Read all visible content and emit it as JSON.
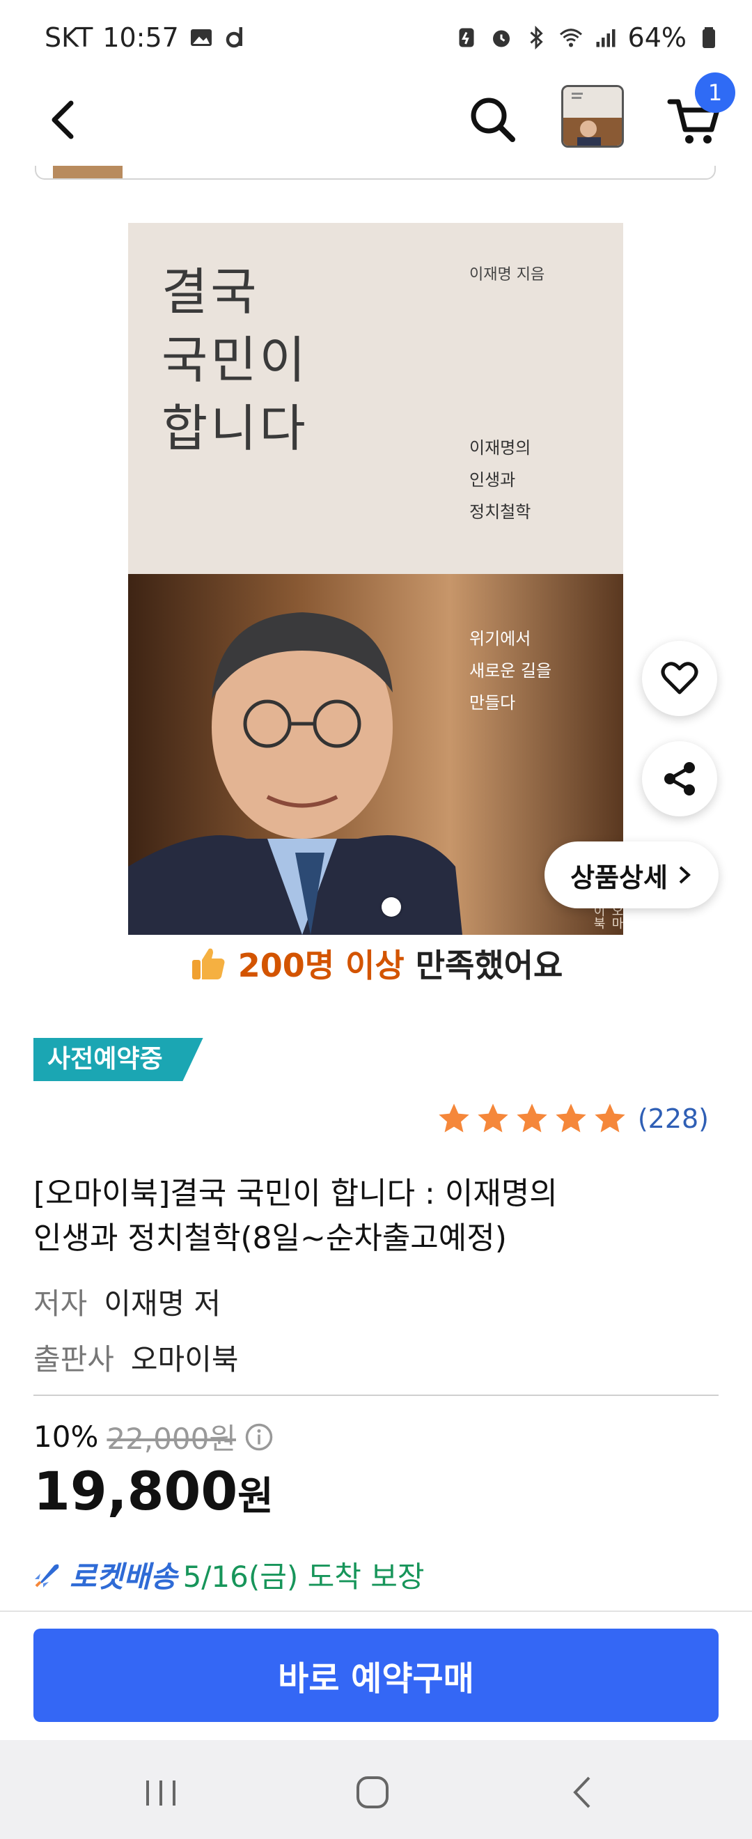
{
  "status_bar": {
    "carrier": "SKT",
    "time": "10:57",
    "battery": "64%"
  },
  "header": {
    "cart_count": "1"
  },
  "cover": {
    "title_lines": [
      "결국",
      "국민이",
      "합니다"
    ],
    "author": "이재명 지음",
    "subtitle_lines": [
      "이재명의",
      "인생과",
      "정치철학"
    ],
    "photo_text_lines": [
      "위기에서",
      "새로운 길을",
      "만들다"
    ],
    "publisher_mark": "오마이북"
  },
  "product": {
    "detail_button": "상품상세",
    "satisfaction_highlight": "200명 이상",
    "satisfaction_rest": "만족했어요",
    "preorder_badge": "사전예약중",
    "rating_count": "(228)",
    "title_line1": "[오마이북]결국 국민이 합니다 : 이재명의",
    "title_line2": "인생과 정치철학(8일~순차출고예정)",
    "author_label": "저자",
    "author_value": "이재명 저",
    "publisher_label": "출판사",
    "publisher_value": "오마이북",
    "discount": "10%",
    "original_price": "22,000원",
    "price_number": "19,800",
    "price_unit": "원",
    "delivery_label": "로켓배송",
    "delivery_date": "5/16(금) 도착 보장",
    "buy_button": "바로 예약구매"
  },
  "colors": {
    "accent_blue": "#3467f5",
    "badge_teal": "#1ba6b3",
    "highlight_orange": "#d35400",
    "star_orange": "#f5873a",
    "delivery_green": "#17955a"
  },
  "icons": [
    "back-arrow-icon",
    "search-icon",
    "cart-icon",
    "heart-icon",
    "share-icon",
    "chevron-right-icon",
    "thumbs-up-icon",
    "star-icon",
    "info-icon",
    "rocket-icon",
    "recent-apps-icon",
    "home-icon",
    "nav-back-icon"
  ]
}
